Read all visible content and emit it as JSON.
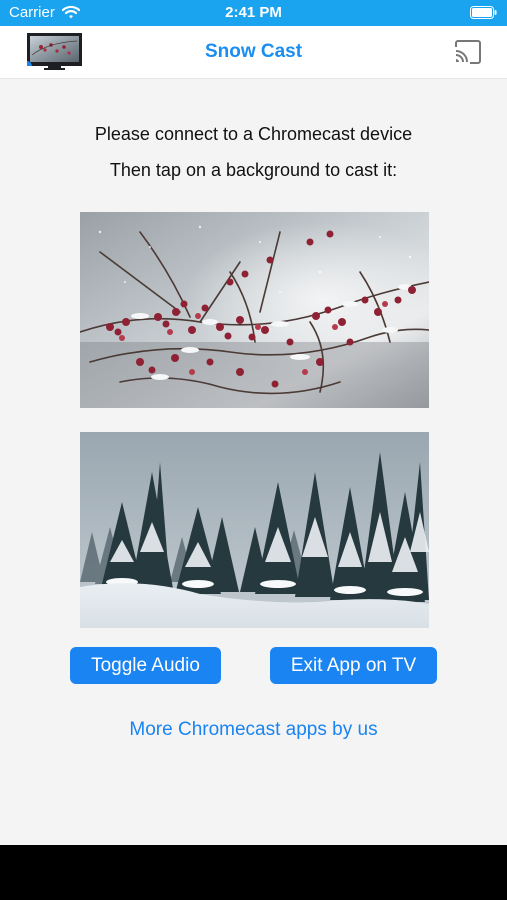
{
  "status_bar": {
    "carrier": "Carrier",
    "time": "2:41 PM",
    "wifi_icon": "wifi-icon",
    "battery_icon": "battery-icon",
    "background_color": "#1aa3ef"
  },
  "nav": {
    "title": "Snow Cast",
    "logo_icon": "tv-app-logo",
    "cast_icon": "cast-icon",
    "title_color": "#1a8ef0"
  },
  "content": {
    "instruction_line1": "Please connect to a Chromecast device",
    "instruction_line2": "Then tap on a background to cast it:",
    "backgrounds": [
      {
        "name": "snowy-berries-background"
      },
      {
        "name": "snowy-forest-background"
      }
    ]
  },
  "buttons": {
    "toggle_audio": "Toggle Audio",
    "exit_app": "Exit App on TV",
    "color": "#1a84f2"
  },
  "links": {
    "more_apps": "More Chromecast apps by us"
  }
}
